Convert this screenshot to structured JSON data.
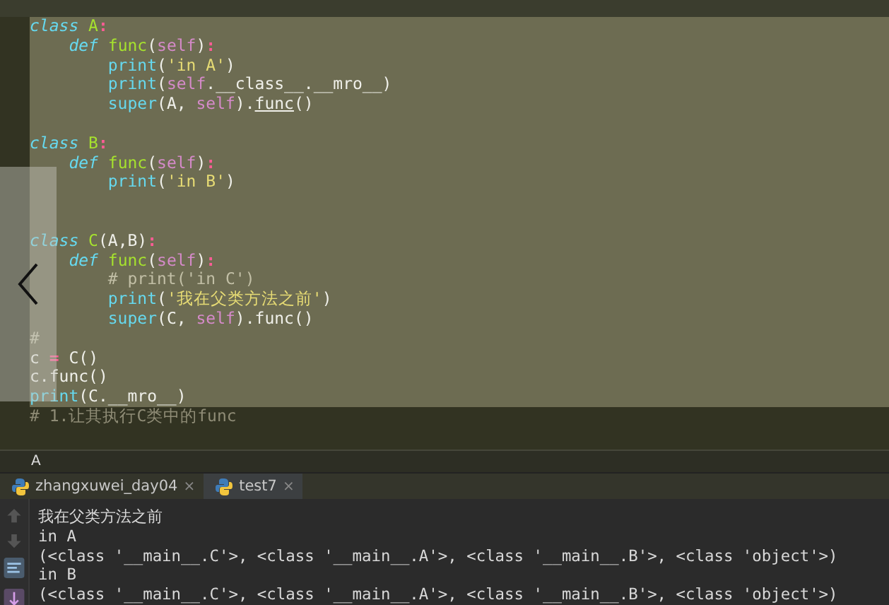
{
  "editor": {
    "lines": [
      {
        "selected": true,
        "tokens": [
          {
            "t": "class ",
            "kind": "kw"
          },
          {
            "t": "A",
            "kind": "fn"
          },
          {
            "t": ":",
            "kind": "op"
          }
        ]
      },
      {
        "selected": true,
        "tokens": [
          {
            "t": "    def ",
            "kind": "kw"
          },
          {
            "t": "func",
            "kind": "fn"
          },
          {
            "t": "(",
            "kind": "txt"
          },
          {
            "t": "self",
            "kind": "self"
          },
          {
            "t": ")",
            "kind": "txt"
          },
          {
            "t": ":",
            "kind": "op"
          }
        ]
      },
      {
        "selected": true,
        "tokens": [
          {
            "t": "        print",
            "kind": "bi"
          },
          {
            "t": "(",
            "kind": "txt"
          },
          {
            "t": "'in A'",
            "kind": "str"
          },
          {
            "t": ")",
            "kind": "txt"
          }
        ]
      },
      {
        "selected": true,
        "tokens": [
          {
            "t": "        print",
            "kind": "bi"
          },
          {
            "t": "(",
            "kind": "txt"
          },
          {
            "t": "self",
            "kind": "self"
          },
          {
            "t": ".__class__.__mro__)",
            "kind": "txt"
          }
        ]
      },
      {
        "selected": true,
        "tokens": [
          {
            "t": "        super",
            "kind": "bi"
          },
          {
            "t": "(A, ",
            "kind": "txt"
          },
          {
            "t": "self",
            "kind": "self"
          },
          {
            "t": ").",
            "kind": "txt"
          },
          {
            "t": "func",
            "kind": "u"
          },
          {
            "t": "()",
            "kind": "txt"
          }
        ]
      },
      {
        "selected": true
      },
      {
        "selected": true,
        "tokens": [
          {
            "t": "class ",
            "kind": "kw"
          },
          {
            "t": "B",
            "kind": "fn"
          },
          {
            "t": ":",
            "kind": "op"
          }
        ]
      },
      {
        "selected": true,
        "tokens": [
          {
            "t": "    def ",
            "kind": "kw"
          },
          {
            "t": "func",
            "kind": "fn"
          },
          {
            "t": "(",
            "kind": "txt"
          },
          {
            "t": "self",
            "kind": "self"
          },
          {
            "t": ")",
            "kind": "txt"
          },
          {
            "t": ":",
            "kind": "op"
          }
        ]
      },
      {
        "selected": true,
        "tokens": [
          {
            "t": "        print",
            "kind": "bi"
          },
          {
            "t": "(",
            "kind": "txt"
          },
          {
            "t": "'in B'",
            "kind": "str"
          },
          {
            "t": ")",
            "kind": "txt"
          }
        ]
      },
      {
        "selected": true
      },
      {
        "selected": true
      },
      {
        "selected": true,
        "tokens": [
          {
            "t": "class ",
            "kind": "kw"
          },
          {
            "t": "C",
            "kind": "fn"
          },
          {
            "t": "(A,B)",
            "kind": "txt"
          },
          {
            "t": ":",
            "kind": "op"
          }
        ]
      },
      {
        "selected": true,
        "tokens": [
          {
            "t": "    def ",
            "kind": "kw"
          },
          {
            "t": "func",
            "kind": "fn"
          },
          {
            "t": "(",
            "kind": "txt"
          },
          {
            "t": "self",
            "kind": "self"
          },
          {
            "t": ")",
            "kind": "txt"
          },
          {
            "t": ":",
            "kind": "op"
          }
        ]
      },
      {
        "selected": true,
        "tokens": [
          {
            "t": "        # print('in C')",
            "kind": "cm"
          }
        ]
      },
      {
        "selected": true,
        "tokens": [
          {
            "t": "        print",
            "kind": "bi"
          },
          {
            "t": "(",
            "kind": "txt"
          },
          {
            "t": "'我在父类方法之前'",
            "kind": "str"
          },
          {
            "t": ")",
            "kind": "txt"
          }
        ]
      },
      {
        "selected": true,
        "tokens": [
          {
            "t": "        super",
            "kind": "bi"
          },
          {
            "t": "(C, ",
            "kind": "txt"
          },
          {
            "t": "self",
            "kind": "self"
          },
          {
            "t": ").func()",
            "kind": "txt"
          }
        ]
      },
      {
        "selected": true,
        "tokens": [
          {
            "t": "#",
            "kind": "cm"
          }
        ]
      },
      {
        "selected": true,
        "tokens": [
          {
            "t": "c ",
            "kind": "txt"
          },
          {
            "t": "=",
            "kind": "op"
          },
          {
            "t": " C()",
            "kind": "txt"
          }
        ]
      },
      {
        "selected": true,
        "tokens": [
          {
            "t": "c.func()",
            "kind": "txt"
          }
        ]
      },
      {
        "selected": true,
        "tokens": [
          {
            "t": "print",
            "kind": "bi"
          },
          {
            "t": "(C.__mro__)",
            "kind": "txt"
          }
        ]
      },
      {
        "selected": false,
        "tokens": [
          {
            "t": "# 1.让其执行C类中的func",
            "kind": "cm"
          }
        ]
      }
    ]
  },
  "breadcrumb": "A",
  "run_tabs": [
    {
      "label": "zhangxuwei_day04",
      "close": "×",
      "selected": false
    },
    {
      "label": "test7",
      "close": "×",
      "selected": true
    }
  ],
  "output": [
    "我在父类方法之前",
    "in A",
    "(<class '__main__.C'>, <class '__main__.A'>, <class '__main__.B'>, <class 'object'>)",
    "in B",
    "(<class '__main__.C'>, <class '__main__.A'>, <class '__main__.B'>, <class 'object'>)"
  ]
}
